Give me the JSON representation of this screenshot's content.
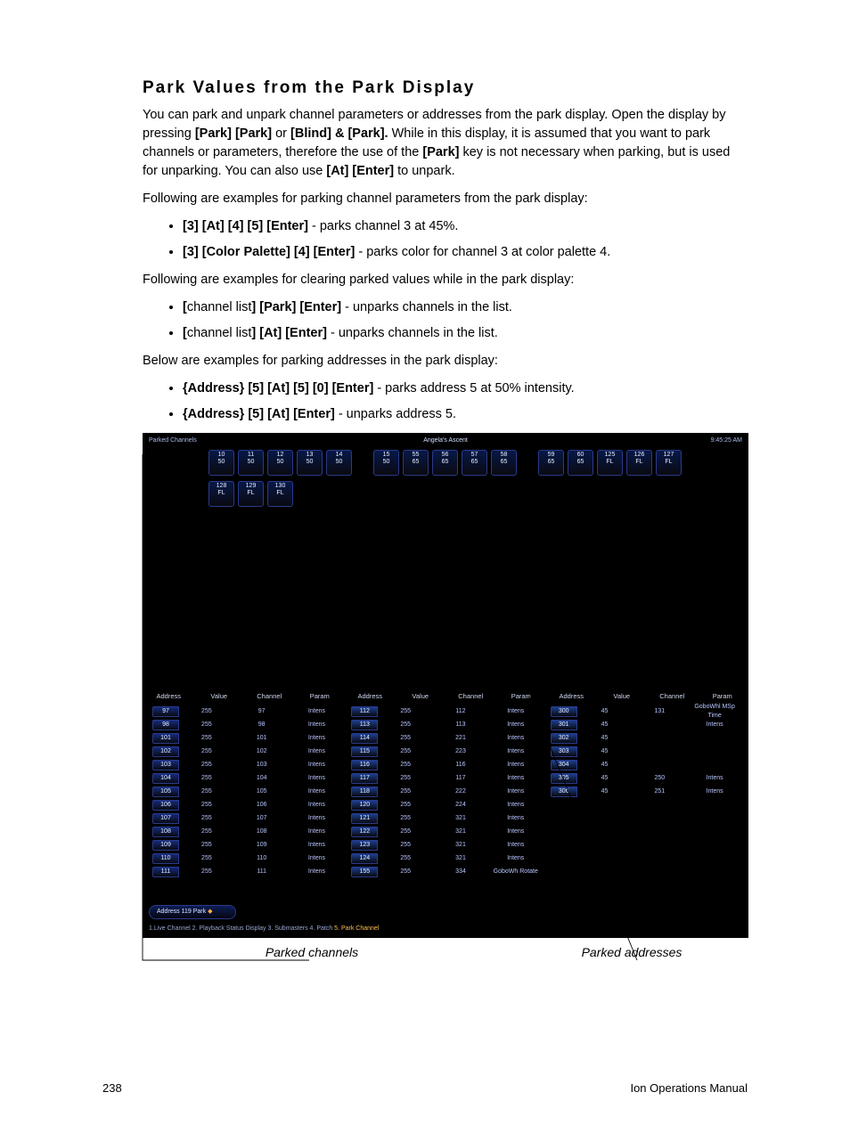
{
  "doc": {
    "heading": "Park Values from the Park Display",
    "para1_a": "You can park and unpark channel parameters or addresses from the park display. Open the display by pressing ",
    "para1_b1": "[Park] [Park]",
    "para1_c": " or ",
    "para1_b2": "[Blind] & [Park].",
    "para1_d": " While in this display, it is assumed that you want to park channels or parameters, therefore the use of the ",
    "para1_b3": "[Park]",
    "para1_e": " key is not necessary when parking, but is used for unparking. You can also use ",
    "para1_b4": "[At] [Enter]",
    "para1_f": " to unpark.",
    "para2": "Following are examples for parking channel parameters from the park display:",
    "li1_b": "[3] [At] [4] [5] [Enter]",
    "li1_t": " - parks channel 3 at 45%.",
    "li2_b": "[3] [Color Palette] [4] [Enter]",
    "li2_t": " - parks color for channel 3 at color palette 4.",
    "para3": "Following are examples for clearing parked values while in the park display:",
    "li3_b1": "[",
    "li3_m1": "channel list",
    "li3_b2": "] [Park] [Enter]",
    "li3_t": " - unparks channels in the list.",
    "li4_b1": "[",
    "li4_m1": "channel list",
    "li4_b2": "] [At] [Enter]",
    "li4_t": " - unparks channels in the list.",
    "para4": "Below are examples for parking addresses in the park display:",
    "li5_b": "{Address} [5] [At] [5] [0] [Enter]",
    "li5_t": " - parks address 5 at 50% intensity.",
    "li6_b": "{Address} [5] [At] [Enter]",
    "li6_t": " - unparks address 5.",
    "callout_left": "Parked channels",
    "callout_right": "Parked addresses",
    "page_num": "238",
    "manual_name": "Ion Operations Manual"
  },
  "shot": {
    "top_left": "Parked Channels",
    "top_mid": "Angela's Ascent",
    "top_right": "9:45:25 AM",
    "tiles_row1": [
      {
        "n": "10",
        "v": "50"
      },
      {
        "n": "11",
        "v": "50"
      },
      {
        "n": "12",
        "v": "50"
      },
      {
        "n": "13",
        "v": "50"
      },
      {
        "n": "14",
        "v": "50"
      },
      {
        "n": "15",
        "v": "50",
        "sep": true
      },
      {
        "n": "55",
        "v": "65"
      },
      {
        "n": "56",
        "v": "65"
      },
      {
        "n": "57",
        "v": "65"
      },
      {
        "n": "58",
        "v": "65"
      },
      {
        "n": "59",
        "v": "65",
        "sep": true
      },
      {
        "n": "60",
        "v": "65"
      },
      {
        "n": "125",
        "v": "FL"
      },
      {
        "n": "126",
        "v": "FL"
      },
      {
        "n": "127",
        "v": "FL"
      }
    ],
    "tiles_row2": [
      {
        "n": "128",
        "v": "FL"
      },
      {
        "n": "129",
        "v": "FL"
      },
      {
        "n": "130",
        "v": "FL"
      }
    ],
    "headers": [
      "Address",
      "Value",
      "Channel",
      "Param"
    ],
    "col1": [
      {
        "a": "97",
        "v": "255",
        "c": "97",
        "p": "Intens"
      },
      {
        "a": "98",
        "v": "255",
        "c": "98",
        "p": "Intens"
      },
      {
        "a": "101",
        "v": "255",
        "c": "101",
        "p": "Intens"
      },
      {
        "a": "102",
        "v": "255",
        "c": "102",
        "p": "Intens"
      },
      {
        "a": "103",
        "v": "255",
        "c": "103",
        "p": "Intens"
      },
      {
        "a": "104",
        "v": "255",
        "c": "104",
        "p": "Intens"
      },
      {
        "a": "105",
        "v": "255",
        "c": "105",
        "p": "Intens"
      },
      {
        "a": "106",
        "v": "255",
        "c": "106",
        "p": "Intens"
      },
      {
        "a": "107",
        "v": "255",
        "c": "107",
        "p": "Intens"
      },
      {
        "a": "108",
        "v": "255",
        "c": "108",
        "p": "Intens"
      },
      {
        "a": "109",
        "v": "255",
        "c": "109",
        "p": "Intens"
      },
      {
        "a": "110",
        "v": "255",
        "c": "110",
        "p": "Intens"
      },
      {
        "a": "111",
        "v": "255",
        "c": "111",
        "p": "Intens"
      }
    ],
    "col2": [
      {
        "a": "112",
        "v": "255",
        "c": "112",
        "p": "Intens"
      },
      {
        "a": "113",
        "v": "255",
        "c": "113",
        "p": "Intens"
      },
      {
        "a": "114",
        "v": "255",
        "c": "221",
        "p": "Intens"
      },
      {
        "a": "115",
        "v": "255",
        "c": "223",
        "p": "Intens"
      },
      {
        "a": "116",
        "v": "255",
        "c": "116",
        "p": "Intens"
      },
      {
        "a": "117",
        "v": "255",
        "c": "117",
        "p": "Intens"
      },
      {
        "a": "118",
        "v": "255",
        "c": "222",
        "p": "Intens"
      },
      {
        "a": "120",
        "v": "255",
        "c": "224",
        "p": "Intens"
      },
      {
        "a": "121",
        "v": "255",
        "c": "321",
        "p": "Intens"
      },
      {
        "a": "122",
        "v": "255",
        "c": "321",
        "p": "Intens"
      },
      {
        "a": "123",
        "v": "255",
        "c": "321",
        "p": "Intens"
      },
      {
        "a": "124",
        "v": "255",
        "c": "321",
        "p": "Intens"
      },
      {
        "a": "155",
        "v": "255",
        "c": "334",
        "p": "GoboWh Rotate"
      }
    ],
    "col3": [
      {
        "a": "300",
        "v": "45",
        "c": "131",
        "p": "GoboWhl MSp Time"
      },
      {
        "a": "301",
        "v": "45",
        "c": "",
        "p": "Intens"
      },
      {
        "a": "302",
        "v": "45",
        "c": "",
        "p": ""
      },
      {
        "a": "303",
        "v": "45",
        "c": "",
        "p": ""
      },
      {
        "a": "304",
        "v": "45",
        "c": "",
        "p": ""
      },
      {
        "a": "305",
        "v": "45",
        "c": "250",
        "p": "Intens"
      },
      {
        "a": "306",
        "v": "45",
        "c": "251",
        "p": "Intens"
      }
    ],
    "cmd_text": "Address 119 Park ",
    "cmd_cursor": "◆",
    "tabs_a": "1.Live Channel    2. Playback Status Display    3. Submasters    4. Patch    ",
    "tabs_sel": "5. Park Channel"
  }
}
